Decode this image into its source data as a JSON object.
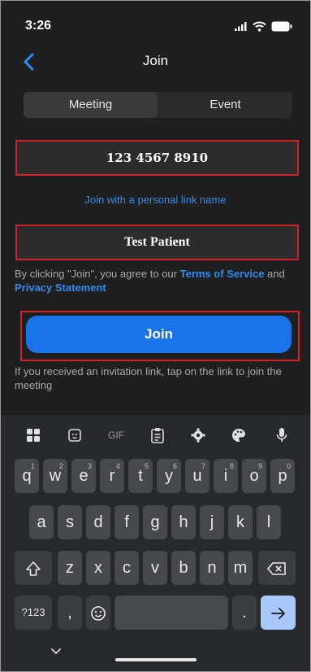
{
  "status_bar": {
    "time": "3:26"
  },
  "nav": {
    "title": "Join"
  },
  "tabs": [
    {
      "label": "Meeting",
      "selected": true
    },
    {
      "label": "Event",
      "selected": false
    }
  ],
  "meeting_id": {
    "value": "123 4567 8910"
  },
  "personal_link": {
    "label": "Join with a personal link name"
  },
  "display_name": {
    "value": "Test Patient"
  },
  "terms": {
    "prefix": "By clicking \"Join\", you agree to our ",
    "terms_link": "Terms of Service",
    "and": " and ",
    "privacy_link": "Privacy Statement"
  },
  "join_button": {
    "label": "Join"
  },
  "hint": {
    "text": "If you received an invitation link, tap on the link to join the meeting"
  },
  "keyboard": {
    "toolbar": {
      "gif_label": "GIF"
    },
    "row1": [
      "q",
      "w",
      "e",
      "r",
      "t",
      "y",
      "u",
      "i",
      "o",
      "p"
    ],
    "row1_digits": [
      "1",
      "2",
      "3",
      "4",
      "5",
      "6",
      "7",
      "8",
      "9",
      "0"
    ],
    "row2": [
      "a",
      "s",
      "d",
      "f",
      "g",
      "h",
      "j",
      "k",
      "l"
    ],
    "row3": [
      "z",
      "x",
      "c",
      "v",
      "b",
      "n",
      "m"
    ],
    "symbols_key": "?123",
    "comma_key": ",",
    "period_key": "."
  },
  "accent_colors": {
    "link": "#2f8cf0",
    "join": "#1a73e8",
    "highlight": "#d12229"
  }
}
